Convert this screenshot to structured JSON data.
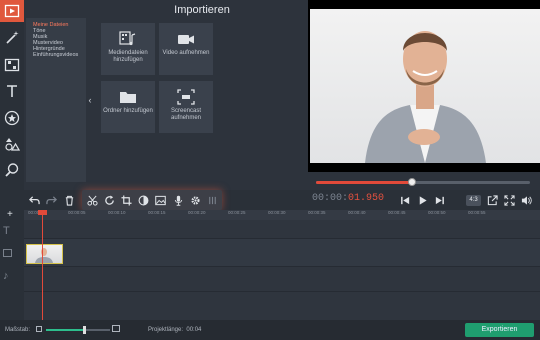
{
  "panel": {
    "title": "Importieren"
  },
  "categories": [
    {
      "label": "Meine Dateien",
      "selected": true
    },
    {
      "label": "Töne",
      "selected": false
    },
    {
      "label": "Musik",
      "selected": false
    },
    {
      "label": "Mustervideo",
      "selected": false
    },
    {
      "label": "Hintergründe",
      "selected": false
    },
    {
      "label": "Einführungsvideos",
      "selected": false
    }
  ],
  "tiles": {
    "media": "Mediendateien hinzufügen",
    "video": "Video aufnehmen",
    "folder": "Ordner hinzufügen",
    "screencast": "Screencast aufnehmen"
  },
  "player": {
    "time_prefix": "00:00:",
    "time_value": "01.950",
    "ratio": "4:3",
    "progress": 0.45
  },
  "ruler": {
    "ticks": [
      "00:00:00",
      "00:00:05",
      "00:00:10",
      "00:00:15",
      "00:00:20",
      "00:00:25",
      "00:00:30",
      "00:00:35",
      "00:00:40",
      "00:00:45",
      "00:00:50",
      "00:00:55"
    ]
  },
  "footer": {
    "zoom_label": "Maßstab:",
    "zoom_level": 0.6,
    "length_label": "Projektlänge:",
    "length_value": "00:04",
    "export_label": "Exportieren"
  },
  "colors": {
    "accent": "#e0583d",
    "export": "#1f9e6f",
    "playhead": "#e24a3a"
  }
}
